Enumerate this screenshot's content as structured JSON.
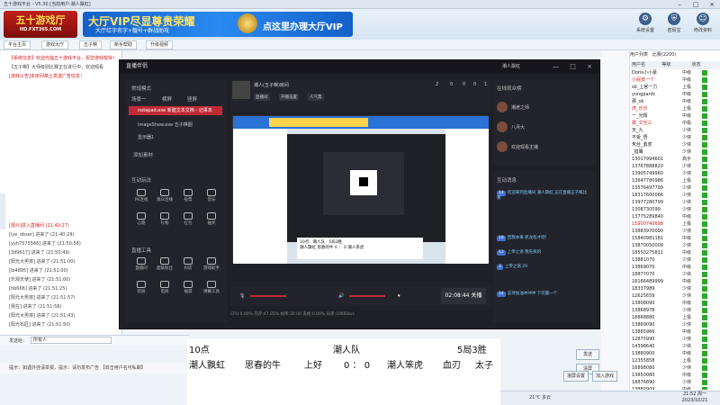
{
  "window": {
    "title": "五十游戏平台 - V5.30 [当前用户:潮人飘虹]"
  },
  "banner": {
    "logo_text": "五十游戏厅",
    "logo_url": "HD.FXT365.COM",
    "vip_title": "大厅VIP尽显尊贵荣耀",
    "vip_sub": "大厅红字名字+靓号+群战助攻",
    "vip_cta": "点这里办理大厅VIP",
    "top_icons": [
      {
        "icon": "gear-icon",
        "label": "系统设置"
      },
      {
        "icon": "shield-icon",
        "label": "密码宝"
      },
      {
        "icon": "person-icon",
        "label": "修改资料"
      }
    ]
  },
  "nav": {
    "tabs": [
      "平台主页",
      "游戏大厅",
      "五子棋",
      "新手帮助",
      "升级视频"
    ]
  },
  "leftpanel": {
    "lines": [
      {
        "text": "【系统信息】欢迎光临五十游戏平台，祝您游戏愉快！",
        "red": true
      },
      {
        "text": "【五子棋】大师级别比赛正在进行中，欢迎观看",
        "red": false
      },
      {
        "text": "[游戏公告]本房间禁止发送广告信息！",
        "red": true
      },
      {
        "text": "[观众]进入直播间 (21:40:27)",
        "red": true
      },
      {
        "text": "[lye_obser] 进来了 (21:40:29)",
        "red": false
      },
      {
        "text": "[yyh7575566] 进来了 (21:50:58)",
        "red": false
      },
      {
        "text": "[3d9617] 进来了 (21:50:49)",
        "red": false
      },
      {
        "text": "[阳光大男孩] 进来了 (21:51:00)",
        "red": false
      },
      {
        "text": "[lb4895] 进来了 (21:51:00)",
        "red": false
      },
      {
        "text": "[乐观天使] 进来了 (21:51:00)",
        "red": false
      },
      {
        "text": "[hb666] 进来了 (21:51:25)",
        "red": false
      },
      {
        "text": "[阳光大男孩] 进来了 (21:51:57)",
        "red": false
      },
      {
        "text": "[我在] 进来了 (21:51:58)",
        "red": false
      },
      {
        "text": "[阳光大男孩] 进来了 (21:51:43)",
        "red": false
      },
      {
        "text": "[阳光石匠] 进来了 (21:51:50)",
        "red": false
      }
    ],
    "chat_to_label": "发送给：",
    "chat_target": "所有人",
    "send_label": "发送",
    "ticker": "提示：如遇外挂请举报，提示：请勿发布广告 【双击用户名可私聊】"
  },
  "studio": {
    "app_name": "直播伴侣",
    "user": "潮人飘虹",
    "scene_header": "常规模式",
    "scene_tab_a": "横屏",
    "scene_tab_b": "竖屏",
    "add_scene": "场景一",
    "sources": [
      {
        "label": "notepad.exe 新建文本文档 - 记事本",
        "active": true
      },
      {
        "label": "ImageShow.exe 五子棋图",
        "active": false
      },
      {
        "label": "显示器1",
        "active": false
      }
    ],
    "add_source": "添加素材",
    "interact_title": "互动玩法",
    "tools_row1": [
      "PK连线",
      "观众连线",
      "投票",
      "音乐"
    ],
    "tools_row2": [
      "心愿",
      "礼物",
      "红包",
      "抽奖"
    ],
    "live_tools_title": "直播工具",
    "tools_row3": [
      "直播间",
      "超级粉丝",
      "抖店",
      "游戏助手"
    ],
    "tools_row4": [
      "装扮",
      "电商",
      "福袋",
      "弹幕工具"
    ],
    "room_title": "潮人(五子棋)房间",
    "room_btns": [
      "直播间",
      "开播设置",
      "人气票"
    ],
    "stats": [
      "2",
      "0",
      "0",
      "0",
      "1"
    ],
    "time": "02:08:44",
    "live_btn": "关播",
    "status": "CPU:0.00%  内存:47.85%  帧率:30.00  丢帧:0.00%  码率:1966kb/s",
    "audience_title": "在线观众榜",
    "audience": [
      "潮老之师",
      "八月大",
      "欢迎观看主播"
    ],
    "interact_msgs_title": "互动消息",
    "msgs": [
      {
        "lv": "14",
        "text": "欢迎来到直播间 潮人飘虹 正在直播五子棋比赛"
      },
      {
        "lv": "18",
        "text": "回我本来 抓龙有才吧!"
      },
      {
        "lv": "12",
        "text": "上帝之语 我先拆的"
      },
      {
        "lv": "3",
        "text": "上帝之语 29"
      },
      {
        "lv": "14",
        "text": "支持加油冲冲冲 下次赢一个"
      }
    ]
  },
  "overlay": {
    "time": "10点",
    "team": "潮人队",
    "result": "5局3胜",
    "p1": "潮人飘虹",
    "p2": "思春的牛",
    "status": "上好",
    "score": "0 ： 0",
    "p3": "潮人笨虎",
    "p4": "血刃",
    "p5": "太子"
  },
  "rightpanel": {
    "tab_a": "用户列表",
    "tab_b": "比赛(2200)",
    "col_name": "用户名",
    "col_level": "等级",
    "col_state": "状态",
    "users": [
      {
        "name": "Doris小小豪",
        "level": "中级",
        "red": false
      },
      {
        "name": "小屁孩一个",
        "level": "中级",
        "red": true
      },
      {
        "name": "sb_上官一力",
        "level": "上极",
        "red": false
      },
      {
        "name": "yongpanfc",
        "level": "中级",
        "red": false
      },
      {
        "name": "那_ok",
        "level": "中级",
        "red": false
      },
      {
        "name": "虎_乐乐",
        "level": "上极",
        "red": true
      },
      {
        "name": "一_光辉",
        "level": "中级",
        "red": false
      },
      {
        "name": "那_文光三",
        "level": "中极",
        "red": true
      },
      {
        "name": "天_九",
        "level": "少侠",
        "red": false
      },
      {
        "name": "不受_悟",
        "level": "少侠",
        "red": false
      },
      {
        "name": "朱丝_勇虎",
        "level": "少侠",
        "red": false
      },
      {
        "name": "_猎鹰",
        "level": "少侠",
        "red": false
      },
      {
        "name": "13017994601",
        "level": "高手",
        "red": false
      },
      {
        "name": "13767888820",
        "level": "少侠",
        "red": false
      },
      {
        "name": "13905749960",
        "level": "少侠",
        "red": false
      },
      {
        "name": "13647780986",
        "level": "上极",
        "red": false
      },
      {
        "name": "13576497799",
        "level": "少侠",
        "red": false
      },
      {
        "name": "18317600066",
        "level": "少侠",
        "red": false
      },
      {
        "name": "13977280799",
        "level": "少侠",
        "red": false
      },
      {
        "name": "1308730599",
        "level": "少侠",
        "red": false
      },
      {
        "name": "13775289840",
        "level": "中级",
        "red": false
      },
      {
        "name": "15900740698",
        "level": "上极",
        "red": true
      },
      {
        "name": "13883970090",
        "level": "少侠",
        "red": false
      },
      {
        "name": "15840981181",
        "level": "中级",
        "red": false
      },
      {
        "name": "13870050009",
        "level": "少侠",
        "red": false
      },
      {
        "name": "18550275811",
        "level": "中级",
        "red": false
      },
      {
        "name": "13881070",
        "level": "少侠",
        "red": false
      },
      {
        "name": "13869070",
        "level": "中级",
        "red": false
      },
      {
        "name": "18877070",
        "level": "少侠",
        "red": false
      },
      {
        "name": "18166489999",
        "level": "中级",
        "red": false
      },
      {
        "name": "18337989",
        "level": "少侠",
        "red": false
      },
      {
        "name": "12625659",
        "level": "少侠",
        "red": false
      },
      {
        "name": "13808090",
        "level": "中级",
        "red": false
      },
      {
        "name": "13868978",
        "level": "少侠",
        "red": false
      },
      {
        "name": "18868880",
        "level": "上极",
        "red": false
      },
      {
        "name": "13869090",
        "level": "少侠",
        "red": false
      },
      {
        "name": "13865966",
        "level": "中级",
        "red": false
      },
      {
        "name": "12875990",
        "level": "少侠",
        "red": false
      },
      {
        "name": "14398640",
        "level": "少侠",
        "red": false
      },
      {
        "name": "13880900",
        "level": "中级",
        "red": false
      },
      {
        "name": "12355858",
        "level": "上极",
        "red": false
      },
      {
        "name": "16898080",
        "level": "少侠",
        "red": false
      },
      {
        "name": "13850080",
        "level": "中级",
        "red": false
      },
      {
        "name": "18876890",
        "level": "少侠",
        "red": false
      },
      {
        "name": "13880909",
        "level": "中级",
        "red": false
      },
      {
        "name": "12580080",
        "level": "少侠",
        "red": false
      }
    ]
  },
  "bottom": {
    "btn_a": "发送",
    "btn_b": "清屏",
    "btn_c": "滚屏设置",
    "btn_d": "加入游戏"
  },
  "taskbar": {
    "weather": "21°C 多云",
    "time": "21:52 周一",
    "date": "2023/10/21"
  }
}
